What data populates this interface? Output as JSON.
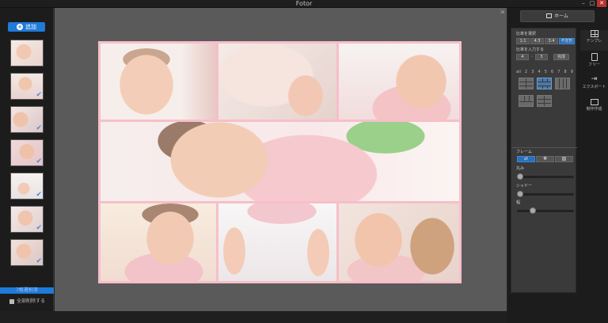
{
  "app": {
    "title": "Fotor"
  },
  "window": {
    "min": "–",
    "max": "□",
    "close": "✕"
  },
  "left": {
    "add_label": "追加",
    "thumb_checks": [
      false,
      true,
      true,
      true,
      true,
      true,
      true
    ],
    "progress_label": "7枚選択済",
    "remove_all_label": "全部削除する"
  },
  "right": {
    "home_label": "ホーム",
    "aspect_label": "比率を選択",
    "aspect_options": [
      "1:1",
      "4:3",
      "3:4",
      "不定形"
    ],
    "custom_ratio_label": "比率を入力する",
    "custom_w": "4",
    "custom_sep": ":",
    "custom_h": "3",
    "custom_apply": "完成",
    "count_options": [
      "all",
      "2",
      "3",
      "4",
      "5",
      "6",
      "7",
      "8",
      "9"
    ],
    "frame_label": "フレーム",
    "frame_options": [
      "⇄",
      "❋",
      "▧"
    ],
    "roundness_label": "丸み",
    "shadow_label": "シャドー",
    "width_label": "幅",
    "roundness_value": 0.0,
    "shadow_value": 0.0,
    "width_value": 0.25,
    "tabs": [
      {
        "label": "テンプレ",
        "icon": "template-grid-icon"
      },
      {
        "label": "フリー",
        "icon": "freestyle-icon"
      },
      {
        "label": "エクスポート",
        "icon": "export-icon"
      },
      {
        "label": "制作作成",
        "icon": "history-icon"
      }
    ]
  },
  "colors": {
    "accent": "#1f7ad8",
    "frame_pink": "#f6bfc9",
    "panel": "#3a3a3a",
    "canvas_bg": "#5a5a5a"
  }
}
